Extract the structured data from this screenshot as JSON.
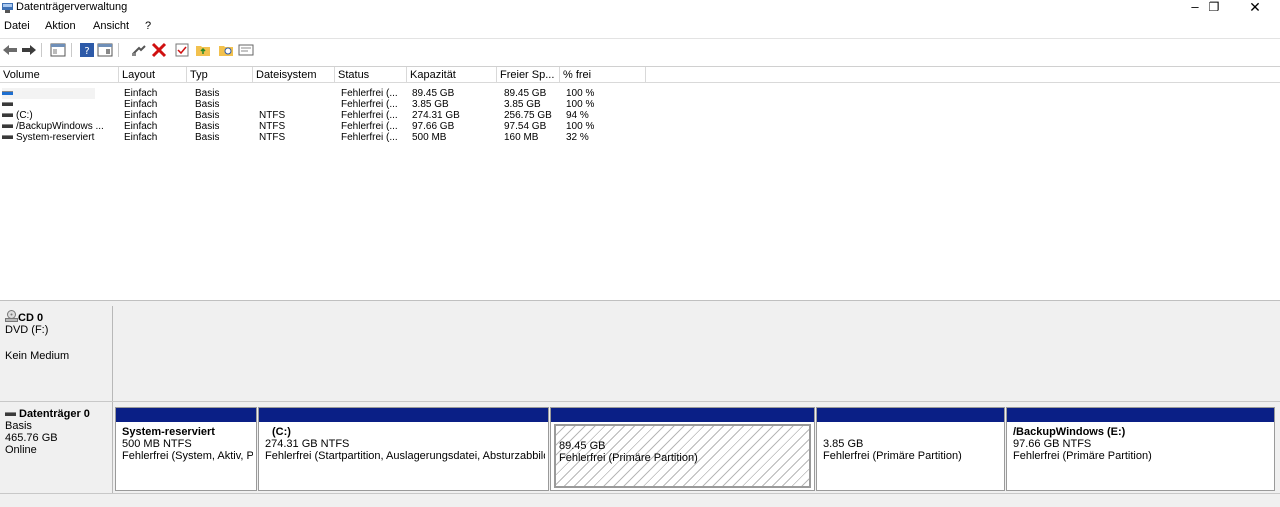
{
  "window": {
    "title": "Datenträgerverwaltung",
    "minimize": "–",
    "maximize": "❐",
    "close": "✕"
  },
  "menu": [
    "Datei",
    "Aktion",
    "Ansicht",
    "?"
  ],
  "toolbar_icons": [
    "back-arrow-icon",
    "forward-arrow-icon",
    "disk-list-icon",
    "help-icon",
    "properties-icon",
    "connect-icon",
    "delete-icon",
    "checkbox-icon",
    "folder-up-icon",
    "folder-search-icon",
    "view-icon"
  ],
  "table": {
    "columns": [
      "Volume",
      "Layout",
      "Typ",
      "Dateisystem",
      "Status",
      "Kapazität",
      "Freier Sp...",
      "% frei"
    ],
    "rows": [
      [
        "",
        "Einfach",
        "Basis",
        "",
        "Fehlerfrei (...",
        "89.45 GB",
        "89.45 GB",
        "100 %"
      ],
      [
        "",
        "Einfach",
        "Basis",
        "",
        "Fehlerfrei (...",
        "3.85 GB",
        "3.85 GB",
        "100 %"
      ],
      [
        "(C:)",
        "Einfach",
        "Basis",
        "NTFS",
        "Fehlerfrei (...",
        "274.31 GB",
        "256.75 GB",
        "94 %"
      ],
      [
        "/BackupWindows ...",
        "Einfach",
        "Basis",
        "NTFS",
        "Fehlerfrei (...",
        "97.66 GB",
        "97.54 GB",
        "100 %"
      ],
      [
        "System-reserviert",
        "Einfach",
        "Basis",
        "NTFS",
        "Fehlerfrei (...",
        "500 MB",
        "160 MB",
        "32 %"
      ]
    ]
  },
  "cd": {
    "name": "CD 0",
    "drive": "DVD (F:)",
    "media": "Kein Medium"
  },
  "disk0": {
    "name": "Datenträger 0",
    "type": "Basis",
    "size": "465.76 GB",
    "state": "Online",
    "partitions": [
      {
        "name": "System-reserviert",
        "size": "500 MB NTFS",
        "status": "Fehlerfrei (System, Aktiv, Primäre Partition)"
      },
      {
        "name": "(C:)",
        "size": "274.31 GB NTFS",
        "status": "Fehlerfrei (Startpartition, Auslagerungsdatei, Absturzabbild, Primäre Partition)"
      },
      {
        "name": "",
        "size": "89.45 GB",
        "status": "Fehlerfrei (Primäre Partition)"
      },
      {
        "name": "",
        "size": "3.85 GB",
        "status": "Fehlerfrei (Primäre Partition)"
      },
      {
        "name": "/BackupWindows  (E:)",
        "size": "97.66 GB NTFS",
        "status": "Fehlerfrei (Primäre Partition)"
      }
    ]
  },
  "colors": {
    "partition_bar": "#0a1f86",
    "panel_bg": "#f0f0f0"
  }
}
